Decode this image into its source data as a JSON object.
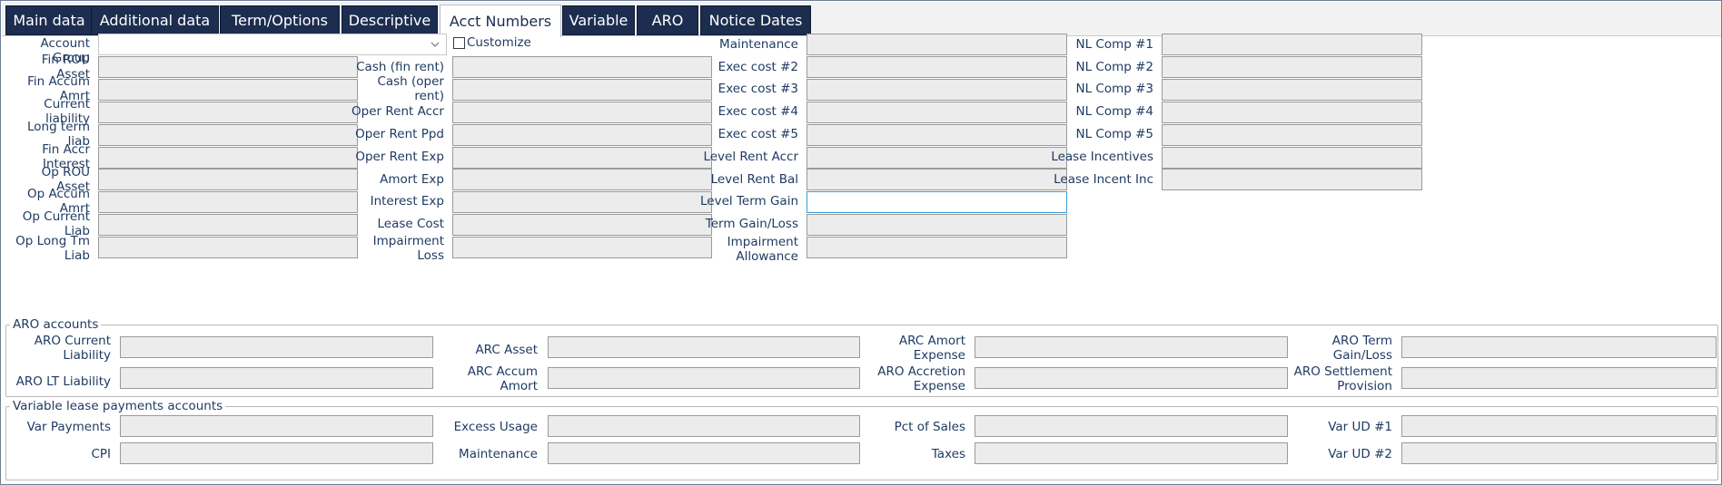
{
  "tabs": [
    {
      "label": "Main data"
    },
    {
      "label": "Additional data"
    },
    {
      "label": "Term/Options"
    },
    {
      "label": "Descriptive"
    },
    {
      "label": "Acct Numbers"
    },
    {
      "label": "Variable"
    },
    {
      "label": "ARO"
    },
    {
      "label": "Notice Dates"
    }
  ],
  "active_tab": "Acct Numbers",
  "fields": {
    "account_group": {
      "label": "Account Group",
      "value": ""
    },
    "customize": {
      "label": "Customize",
      "checked": false
    },
    "col1": [
      "Fin ROU Asset",
      "Fin Accum Amrt",
      "Current liability",
      "Long term liab",
      "Fin Accr Interest",
      "Op ROU Asset",
      "Op Accum Amrt",
      "Op Current Liab",
      "Op Long Tm Liab"
    ],
    "col2": [
      "Cash (fin rent)",
      "Cash (oper rent)",
      "Oper Rent Accr",
      "Oper Rent Ppd",
      "Oper Rent Exp",
      "Amort Exp",
      "Interest Exp",
      "Lease Cost",
      "Impairment Loss"
    ],
    "col3": [
      "Maintenance",
      "Exec cost #2",
      "Exec cost #3",
      "Exec cost #4",
      "Exec cost #5",
      "Level Rent Accr",
      "Level Rent Bal",
      "Level Term Gain",
      "Term Gain/Loss",
      "Impairment Allowance"
    ],
    "col4": [
      "NL Comp #1",
      "NL Comp #2",
      "NL Comp #3",
      "NL Comp #4",
      "NL Comp #5",
      "Lease Incentives",
      "Lease Incent Inc"
    ]
  },
  "aro": {
    "title": "ARO accounts",
    "row1": [
      "ARO Current Liability",
      "ARC Asset",
      "ARC Amort Expense",
      "ARO Term Gain/Loss"
    ],
    "row2": [
      "ARO LT Liability",
      "ARC Accum Amort",
      "ARO Accretion Expense",
      "ARO Settlement Provision"
    ]
  },
  "variable": {
    "title": "Variable lease payments accounts",
    "row1": [
      "Var Payments",
      "Excess Usage",
      "Pct of Sales",
      "Var UD #1"
    ],
    "row2": [
      "CPI",
      "Maintenance",
      "Taxes",
      "Var UD #2"
    ]
  },
  "colors": {
    "tab_bg": "#1c2d4f",
    "label": "#1f3b63",
    "field_bg": "#ececec",
    "focus": "#3b9ad6"
  }
}
